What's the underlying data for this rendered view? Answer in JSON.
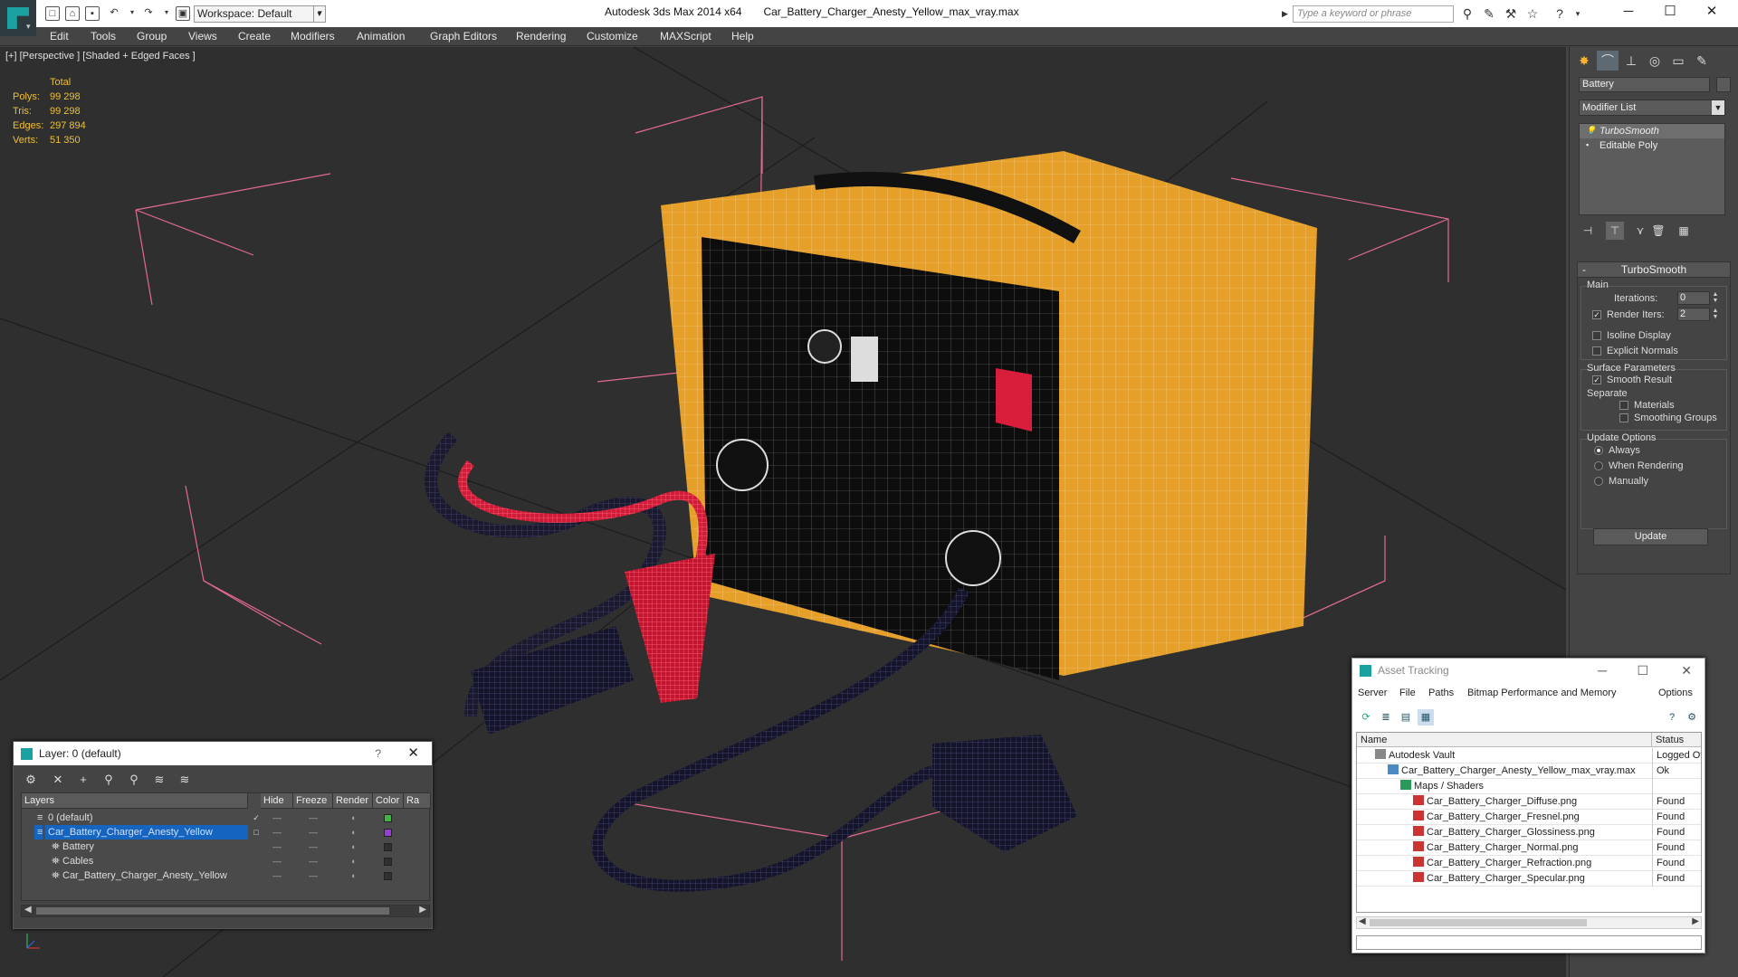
{
  "window": {
    "app_title": "Autodesk 3ds Max  2014 x64",
    "file_title": "Car_Battery_Charger_Anesty_Yellow_max_vray.max",
    "workspace": "Workspace: Default",
    "search_placeholder": "Type a keyword or phrase"
  },
  "menu": [
    "Edit",
    "Tools",
    "Group",
    "Views",
    "Create",
    "Modifiers",
    "Animation",
    "Graph Editors",
    "Rendering",
    "Customize",
    "MAXScript",
    "Help"
  ],
  "viewport": {
    "label": "[+] [Perspective ] [Shaded + Edged Faces ]",
    "stats_header": "Total",
    "stats": [
      {
        "label": "Polys:",
        "value": "99 298"
      },
      {
        "label": "Tris:",
        "value": "99 298"
      },
      {
        "label": "Edges:",
        "value": "297 894"
      },
      {
        "label": "Verts:",
        "value": "51 350"
      }
    ]
  },
  "command_panel": {
    "object_name": "Battery",
    "modifier_list": "Modifier List",
    "stack": [
      "TurboSmooth",
      "Editable Poly"
    ],
    "rollout_title": "TurboSmooth",
    "main_label": "Main",
    "iterations_label": "Iterations:",
    "iterations_value": "0",
    "render_iters_label": "Render Iters:",
    "render_iters_value": "2",
    "isoline_label": "Isoline Display",
    "explicit_normals_label": "Explicit Normals",
    "surface_params_label": "Surface Parameters",
    "smooth_result_label": "Smooth Result",
    "separate_label": "Separate",
    "materials_label": "Materials",
    "smoothing_groups_label": "Smoothing Groups",
    "update_options_label": "Update Options",
    "always_label": "Always",
    "when_rendering_label": "When Rendering",
    "manually_label": "Manually",
    "update_button": "Update"
  },
  "layer_window": {
    "title": "Layer: 0 (default)",
    "help": "?",
    "columns": [
      "Layers",
      "Hide",
      "Freeze",
      "Render",
      "Color",
      "Ra"
    ],
    "rows": [
      {
        "name": "0 (default)",
        "color": "#3cb83c"
      },
      {
        "name": "Car_Battery_Charger_Anesty_Yellow",
        "color": "#9a3cd6"
      },
      {
        "name": "Battery",
        "color": "#303030"
      },
      {
        "name": "Cables",
        "color": "#303030"
      },
      {
        "name": "Car_Battery_Charger_Anesty_Yellow",
        "color": "#303030"
      }
    ]
  },
  "asset_window": {
    "title": "Asset Tracking",
    "menu": [
      "Server",
      "File",
      "Paths",
      "Bitmap Performance and Memory",
      "Options"
    ],
    "col_name": "Name",
    "col_status": "Status",
    "rows": [
      {
        "name": "Autodesk Vault",
        "status": "Logged Of",
        "indent": 0,
        "icon": "vault-icon"
      },
      {
        "name": "Car_Battery_Charger_Anesty_Yellow_max_vray.max",
        "status": "Ok",
        "indent": 1,
        "icon": "max-file-icon"
      },
      {
        "name": "Maps / Shaders",
        "status": "",
        "indent": 2,
        "icon": "maps-folder-icon"
      },
      {
        "name": "Car_Battery_Charger_Diffuse.png",
        "status": "Found",
        "indent": 3,
        "icon": "png-icon"
      },
      {
        "name": "Car_Battery_Charger_Fresnel.png",
        "status": "Found",
        "indent": 3,
        "icon": "png-icon"
      },
      {
        "name": "Car_Battery_Charger_Glossiness.png",
        "status": "Found",
        "indent": 3,
        "icon": "png-icon"
      },
      {
        "name": "Car_Battery_Charger_Normal.png",
        "status": "Found",
        "indent": 3,
        "icon": "png-icon"
      },
      {
        "name": "Car_Battery_Charger_Refraction.png",
        "status": "Found",
        "indent": 3,
        "icon": "png-icon"
      },
      {
        "name": "Car_Battery_Charger_Specular.png",
        "status": "Found",
        "indent": 3,
        "icon": "png-icon"
      }
    ]
  }
}
